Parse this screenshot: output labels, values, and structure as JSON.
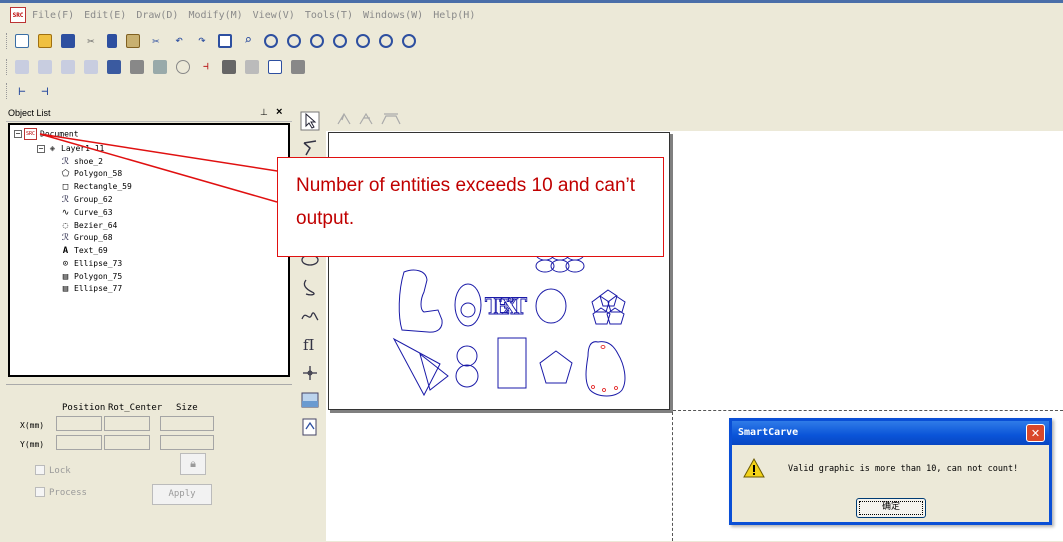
{
  "menubar": {
    "app_icon": "SRC",
    "items": [
      "File(F)",
      "Edit(E)",
      "Draw(D)",
      "Modify(M)",
      "View(V)",
      "Tools(T)",
      "Windows(W)",
      "Help(H)"
    ]
  },
  "object_list": {
    "title": "Object List",
    "pin_icon": "pin-icon",
    "close_glyph": "×",
    "items": [
      {
        "label": "Document",
        "icon": "document-icon"
      },
      {
        "label": "Layer1-11",
        "icon": "layer-icon"
      },
      {
        "label": "shoe_2",
        "icon": "group-icon"
      },
      {
        "label": "Polygon_58",
        "icon": "polygon-icon"
      },
      {
        "label": "Rectangle_59",
        "icon": "rectangle-icon"
      },
      {
        "label": "Group_62",
        "icon": "group-icon"
      },
      {
        "label": "Curve_63",
        "icon": "curve-icon"
      },
      {
        "label": "Bezier_64",
        "icon": "bezier-icon"
      },
      {
        "label": "Group_68",
        "icon": "group-icon"
      },
      {
        "label": "Text_69",
        "icon": "text-icon"
      },
      {
        "label": "Ellipse_73",
        "icon": "ellipse-icon"
      },
      {
        "label": "Polygon_75",
        "icon": "file-icon"
      },
      {
        "label": "Ellipse_77",
        "icon": "file-icon"
      }
    ]
  },
  "properties": {
    "headers": [
      "Position",
      "Rot_Center",
      "Size"
    ],
    "x_label": "X(mm)",
    "y_label": "Y(mm)",
    "lock_label": "Lock",
    "process_label": "Process",
    "apply_label": "Apply"
  },
  "callout": {
    "text": "Number of entities exceeds 10 and can’t output.",
    "color": "#c00000"
  },
  "canvas": {
    "text_shape": "TEXT"
  },
  "dialog": {
    "title": "SmartCarve",
    "message": "Valid graphic is more than 10, can not count!",
    "ok_label": "确定",
    "close_glyph": "✕",
    "warning_icon": "warning-icon"
  },
  "colors": {
    "accent": "#0a54d8",
    "shape_stroke": "#1a1aa8",
    "callout_red": "#e01010"
  }
}
